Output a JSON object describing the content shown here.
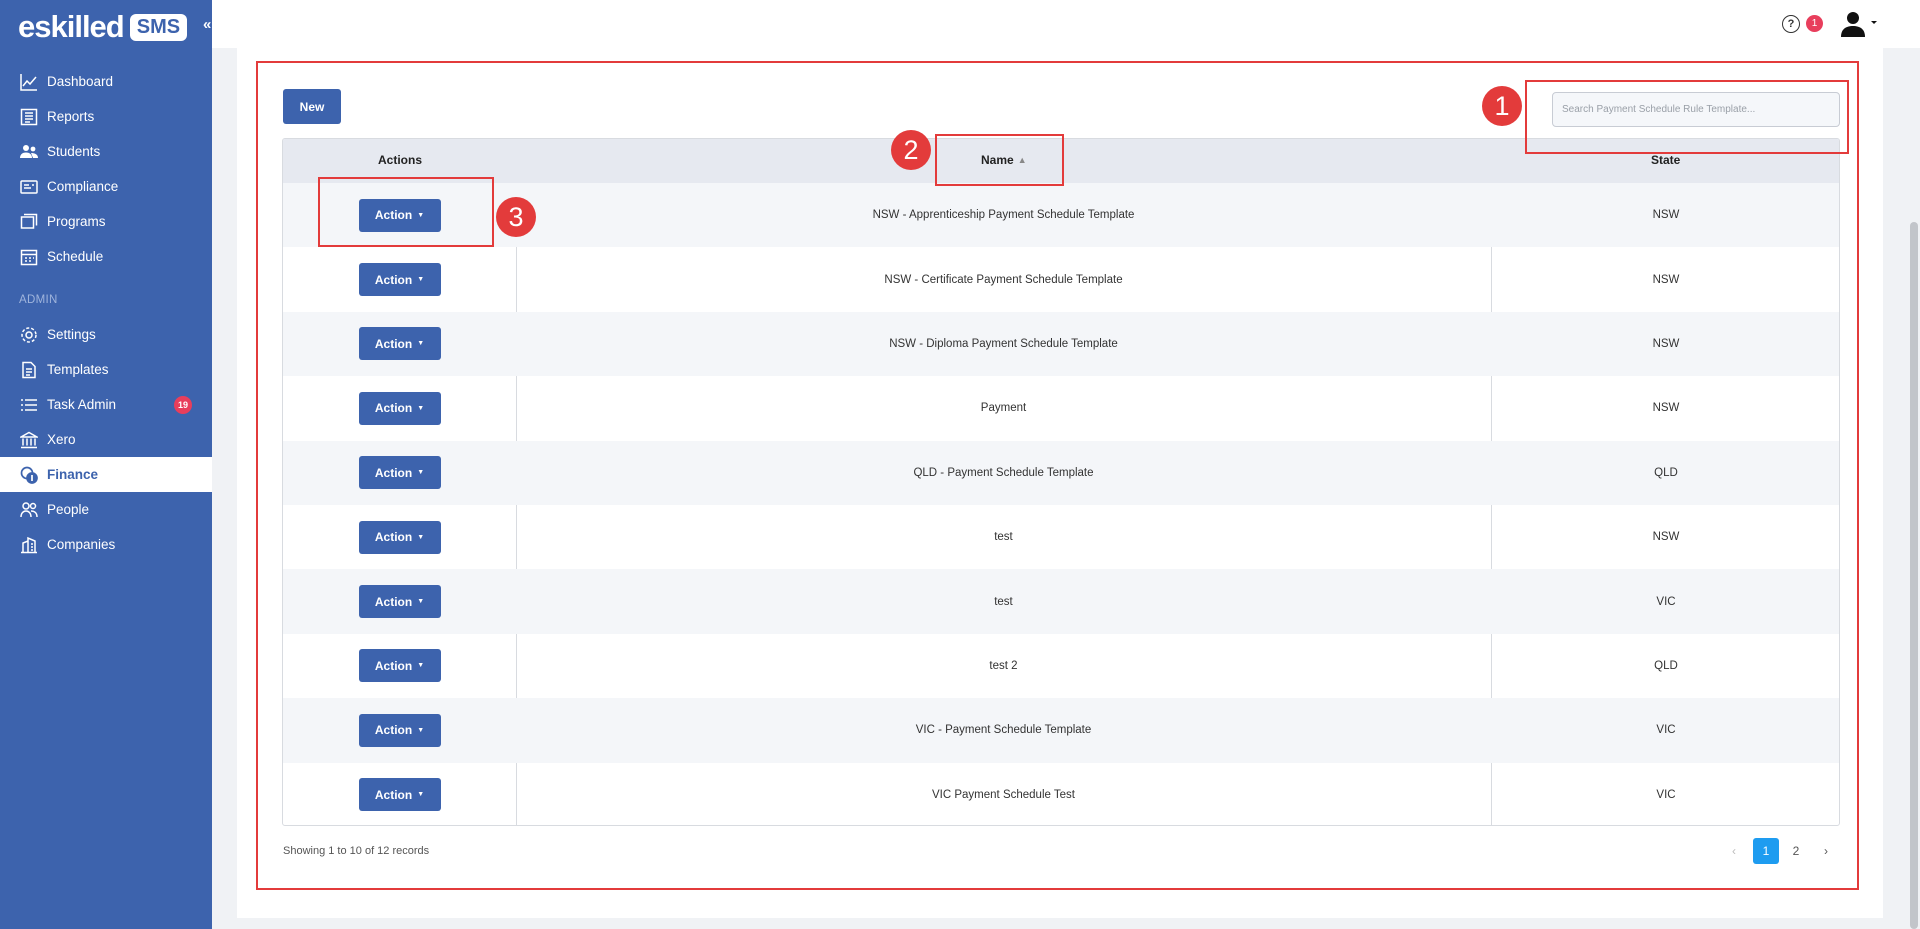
{
  "brand": {
    "logo_text": "eskilled",
    "logo_badge": "SMS"
  },
  "sidebar": {
    "items": [
      {
        "label": "Dashboard",
        "icon": "chart-line-icon"
      },
      {
        "label": "Reports",
        "icon": "report-icon"
      },
      {
        "label": "Students",
        "icon": "users-icon"
      },
      {
        "label": "Compliance",
        "icon": "id-card-icon"
      },
      {
        "label": "Programs",
        "icon": "layers-icon"
      },
      {
        "label": "Schedule",
        "icon": "calendar-icon"
      }
    ],
    "admin_section": "ADMIN",
    "admin_items": [
      {
        "label": "Settings",
        "icon": "gear-icon"
      },
      {
        "label": "Templates",
        "icon": "document-icon"
      },
      {
        "label": "Task Admin",
        "icon": "list-icon",
        "badge": "19"
      },
      {
        "label": "Xero",
        "icon": "bank-icon"
      },
      {
        "label": "Finance",
        "icon": "coins-icon",
        "active": true
      },
      {
        "label": "People",
        "icon": "people-icon"
      },
      {
        "label": "Companies",
        "icon": "building-icon"
      }
    ]
  },
  "topbar": {
    "help_icon": "question-circle-icon",
    "notification_count": "1",
    "user_icon": "user-icon"
  },
  "toolbar": {
    "new_label": "New",
    "search_placeholder": "Search Payment Schedule Rule Template..."
  },
  "table": {
    "headers": {
      "actions": "Actions",
      "name": "Name",
      "state": "State"
    },
    "action_label": "Action",
    "rows": [
      {
        "name": "NSW - Apprenticeship Payment Schedule Template",
        "state": "NSW"
      },
      {
        "name": "NSW - Certificate Payment Schedule Template",
        "state": "NSW"
      },
      {
        "name": "NSW - Diploma Payment Schedule Template",
        "state": "NSW"
      },
      {
        "name": "Payment",
        "state": "NSW"
      },
      {
        "name": "QLD - Payment Schedule Template",
        "state": "QLD"
      },
      {
        "name": "test",
        "state": "NSW"
      },
      {
        "name": "test",
        "state": "VIC"
      },
      {
        "name": "test 2",
        "state": "QLD"
      },
      {
        "name": "VIC - Payment Schedule Template",
        "state": "VIC"
      },
      {
        "name": "VIC Payment Schedule Test",
        "state": "VIC"
      }
    ]
  },
  "footer": {
    "records_text": "Showing 1 to 10 of 12 records",
    "pages": [
      "1",
      "2"
    ],
    "current_page": "1",
    "prev": "‹",
    "next": "›"
  },
  "annotations": {
    "markers": [
      "1",
      "2",
      "3"
    ],
    "color": "#e33b3b"
  },
  "colors": {
    "primary": "#3d63ad",
    "pager_active": "#1e9cf0",
    "badge": "#e83e5c"
  }
}
